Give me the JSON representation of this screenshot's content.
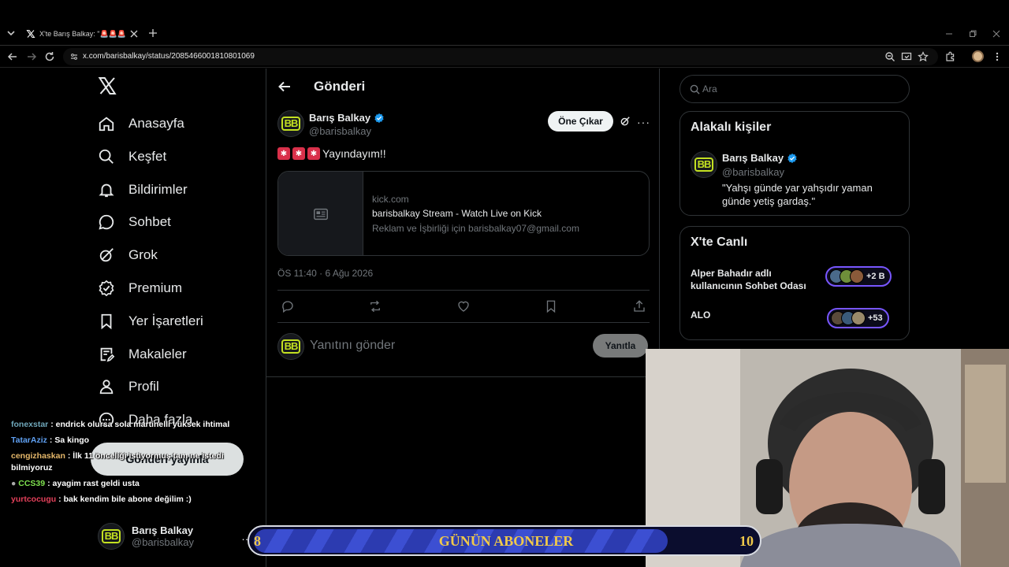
{
  "browser": {
    "tab_title": "X'te Barış Balkay: \"🚨🚨🚨 Yayındayım!!\"",
    "url": "x.com/barisbalkay/status/2085466001810801069"
  },
  "sidebar": {
    "items": [
      {
        "label": "Anasayfa",
        "icon": "home-icon"
      },
      {
        "label": "Keşfet",
        "icon": "search-icon"
      },
      {
        "label": "Bildirimler",
        "icon": "bell-icon"
      },
      {
        "label": "Sohbet",
        "icon": "chat-icon"
      },
      {
        "label": "Grok",
        "icon": "grok-icon"
      },
      {
        "label": "Premium",
        "icon": "premium-icon"
      },
      {
        "label": "Yer İşaretleri",
        "icon": "bookmark-icon"
      },
      {
        "label": "Makaleler",
        "icon": "article-icon"
      },
      {
        "label": "Profil",
        "icon": "profile-icon"
      },
      {
        "label": "Daha fazla",
        "icon": "more-icon"
      }
    ],
    "post_button": "Gönderi yayınla",
    "account": {
      "name": "Barış Balkay",
      "handle": "@barisbalkay"
    }
  },
  "main": {
    "title": "Gönderi",
    "tweet": {
      "author": "Barış Balkay",
      "handle": "@barisbalkay",
      "promote_label": "Öne Çıkar",
      "text": "Yayındayım!!",
      "card": {
        "domain": "kick.com",
        "title": "barisbalkay Stream - Watch Live on Kick",
        "description": "Reklam ve İşbirliği için barisbalkay07@gmail.com"
      },
      "timestamp": "ÖS 11:40 · 6 Ağu 2026"
    },
    "reply": {
      "placeholder": "Yanıtını gönder",
      "button": "Yanıtla"
    }
  },
  "right": {
    "search_placeholder": "Ara",
    "relevant": {
      "title": "Alakalı kişiler",
      "name": "Barış Balkay",
      "handle": "@barisbalkay",
      "bio": "\"Yahşı günde yar yahşıdır yaman günde yetiş gardaş.\""
    },
    "live": {
      "title": "X'te Canlı",
      "rows": [
        {
          "title": "Alper Bahadır adlı kullanıcının Sohbet Odası",
          "count": "+2 B"
        },
        {
          "title": "ALO",
          "count": "+53"
        }
      ]
    }
  },
  "stream": {
    "chat": [
      {
        "nick": "fonexstar",
        "color": "#6fa7ba",
        "msg": ": endrick olursa sola martinelli yüksek ihtimal"
      },
      {
        "nick": "TatarAziz",
        "color": "#5fa0f2",
        "msg": ": Sa kingo"
      },
      {
        "nick": "cengizhaskan",
        "color": "#e6b86a",
        "msg": ": İlk 11 önceliği istiyormuş tam ne istedi bilmiyoruz"
      },
      {
        "nick": "CCS39",
        "color": "#7fe24f",
        "msg": ": ayagim rast geldi usta"
      },
      {
        "nick": "yurtcocugu",
        "color": "#e2405a",
        "msg": ": bak kendim bile abone değilim :)"
      }
    ],
    "banner": {
      "left_num": "8",
      "label": "GÜNÜN ABONELER",
      "right_num": "10"
    }
  },
  "colors": {
    "accent": "#1d9bf0",
    "background": "#000000",
    "live_border": "#7856ff",
    "banner_gold": "#f0c94a"
  }
}
